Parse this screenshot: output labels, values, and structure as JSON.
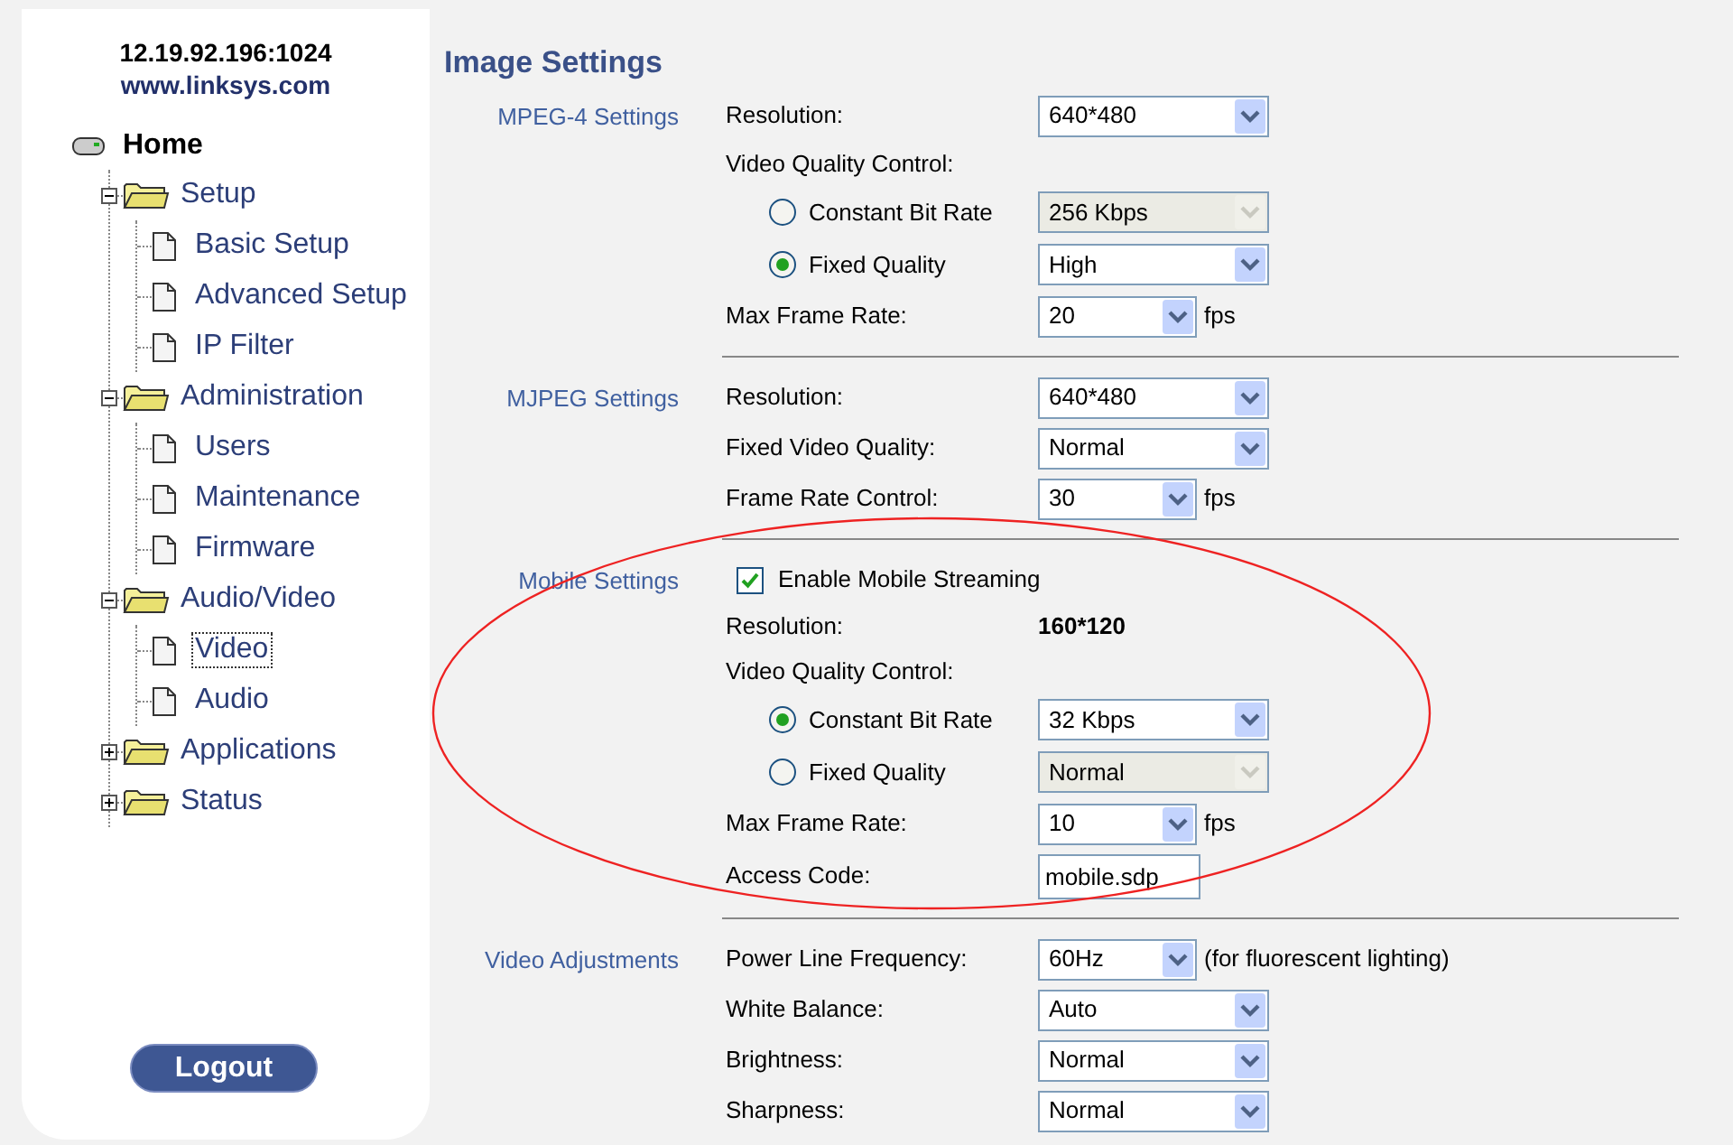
{
  "sidebar": {
    "host": "12.19.92.196:1024",
    "site": "www.linksys.com",
    "home": "Home",
    "tree": [
      {
        "label": "Setup",
        "expanded": true,
        "children": [
          {
            "label": "Basic Setup",
            "selected": false
          },
          {
            "label": "Advanced Setup",
            "selected": false
          },
          {
            "label": "IP Filter",
            "selected": false
          }
        ]
      },
      {
        "label": "Administration",
        "expanded": true,
        "children": [
          {
            "label": "Users",
            "selected": false
          },
          {
            "label": "Maintenance",
            "selected": false
          },
          {
            "label": "Firmware",
            "selected": false
          }
        ]
      },
      {
        "label": "Audio/Video",
        "expanded": true,
        "children": [
          {
            "label": "Video",
            "selected": true
          },
          {
            "label": "Audio",
            "selected": false
          }
        ]
      },
      {
        "label": "Applications",
        "expanded": false
      },
      {
        "label": "Status",
        "expanded": false
      }
    ],
    "logout": "Logout"
  },
  "title": "Image Settings",
  "sections": [
    {
      "label": "MPEG-4 Settings",
      "rows": [
        {
          "kind": "select",
          "label": "Resolution:",
          "value": "640*480",
          "disabled": false
        },
        {
          "kind": "heading",
          "label": "Video Quality Control:"
        },
        {
          "kind": "radio",
          "label": "Constant Bit Rate",
          "selected": false,
          "value": "256 Kbps",
          "disabled": true
        },
        {
          "kind": "radio",
          "label": "Fixed Quality",
          "selected": true,
          "value": "High",
          "disabled": false
        },
        {
          "kind": "select",
          "label": "Max Frame Rate:",
          "value": "20",
          "disabled": false,
          "unit": "fps"
        }
      ]
    },
    {
      "label": "MJPEG Settings",
      "rows": [
        {
          "kind": "select",
          "label": "Resolution:",
          "value": "640*480",
          "disabled": false
        },
        {
          "kind": "select",
          "label": "Fixed Video Quality:",
          "value": "Normal",
          "disabled": false
        },
        {
          "kind": "select",
          "label": "Frame Rate Control:",
          "value": "30",
          "disabled": false,
          "unit": "fps"
        }
      ]
    },
    {
      "label": "Mobile Settings",
      "annotated": true,
      "rows": [
        {
          "kind": "checkbox",
          "label": "Enable Mobile Streaming",
          "checked": true
        },
        {
          "kind": "value",
          "label": "Resolution:",
          "value": "160*120"
        },
        {
          "kind": "heading",
          "label": "Video Quality Control:"
        },
        {
          "kind": "radio",
          "label": "Constant Bit Rate",
          "selected": true,
          "value": "32 Kbps",
          "disabled": false
        },
        {
          "kind": "radio",
          "label": "Fixed Quality",
          "selected": false,
          "value": "Normal",
          "disabled": true
        },
        {
          "kind": "select",
          "label": "Max Frame Rate:",
          "value": "10",
          "disabled": false,
          "unit": "fps"
        },
        {
          "kind": "input",
          "label": "Access Code:",
          "value": "mobile.sdp"
        }
      ]
    },
    {
      "label": "Video Adjustments",
      "rows": [
        {
          "kind": "select",
          "label": "Power Line Frequency:",
          "value": "60Hz",
          "disabled": false,
          "unit": "(for fluorescent lighting)"
        },
        {
          "kind": "select",
          "label": "White Balance:",
          "value": "Auto",
          "disabled": false
        },
        {
          "kind": "select",
          "label": "Brightness:",
          "value": "Normal",
          "disabled": false
        },
        {
          "kind": "select",
          "label": "Sharpness:",
          "value": "Normal",
          "disabled": false
        }
      ]
    }
  ]
}
